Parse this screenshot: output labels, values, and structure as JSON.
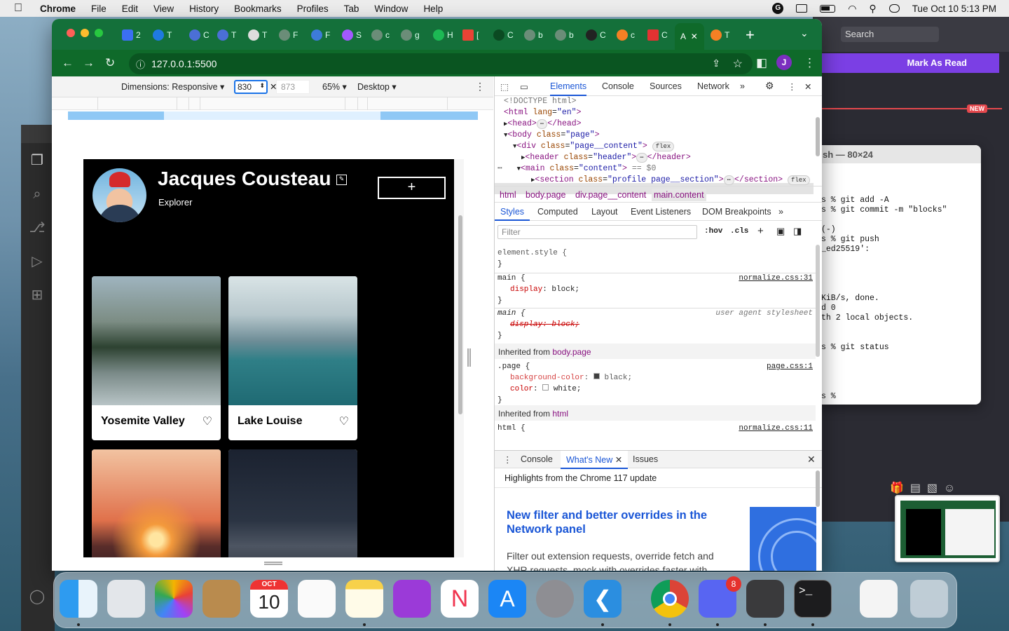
{
  "menubar": {
    "app": "Chrome",
    "items": [
      "File",
      "Edit",
      "View",
      "History",
      "Bookmarks",
      "Profiles",
      "Tab",
      "Window",
      "Help"
    ],
    "datetime": "Tue Oct 10  5:13 PM"
  },
  "background": {
    "search_placeholder": "Search",
    "mark_as_read": "Mark As Read",
    "new_badge": "NEW",
    "terminal_title": "sh — 80×24",
    "terminal_lines": [
      "s % git add -A",
      "s % git commit -m \"blocks\"",
      "(-)",
      "s % git push",
      "_ed25519':",
      "KiB/s, done.",
      "d 0",
      "th 2 local objects.",
      "s % git status",
      "s % "
    ]
  },
  "chrome": {
    "url": "127.0.0.1:5500",
    "tabs": [
      "2",
      "T",
      "C",
      "T",
      "T",
      "F",
      "F",
      "S",
      "c",
      "g",
      "H",
      "[",
      "C",
      "b",
      "b",
      "C",
      "c",
      "C",
      "A",
      "T"
    ],
    "active_tab_label": "A",
    "profile_initial": "J"
  },
  "device_toolbar": {
    "dimensions": "Dimensions: Responsive",
    "width": "830",
    "height": "873",
    "zoom": "65%",
    "mode": "Desktop"
  },
  "page": {
    "name": "Jacques Cousteau",
    "job": "Explorer",
    "add_button": "+",
    "cards": [
      {
        "title": "Yosemite Valley"
      },
      {
        "title": "Lake Louise"
      },
      {
        "title": ""
      },
      {
        "title": ""
      }
    ]
  },
  "devtools": {
    "tabs": [
      "Elements",
      "Console",
      "Sources",
      "Network"
    ],
    "dom": {
      "l1": "<!DOCTYPE html>",
      "l2_tag": "<html ",
      "l2_attr": "lang",
      "l2_val": "\"en\"",
      "l3": "<head>",
      "l3_end": "</head>",
      "l4_tag": "<body ",
      "l4_attr": "class",
      "l4_val": "\"page\"",
      "l5_tag": "<div ",
      "l5_attr": "class",
      "l5_val": "\"page__content\"",
      "l6_tag": "<header ",
      "l6_attr": "class",
      "l6_val": "\"header\"",
      "l6_end": "</header>",
      "l7_tag": "<main ",
      "l7_attr": "class",
      "l7_val": "\"content\"",
      "l7_ref": "== $0",
      "l8_tag": "<section ",
      "l8_attr": "class",
      "l8_val": "\"profile page__section\"",
      "l8_end": "</section>",
      "pill": "flex"
    },
    "breadcrumbs": [
      "html",
      "body.page",
      "div.page__content",
      "main.content"
    ],
    "style_tabs": [
      "Styles",
      "Computed",
      "Layout",
      "Event Listeners",
      "DOM Breakpoints"
    ],
    "filter_placeholder": "Filter",
    "hov": ":hov",
    "cls": ".cls",
    "rules": {
      "element_style": "element.style {",
      "close": "}",
      "main_sel": "main {",
      "main_prop": "display",
      "main_val": "block;",
      "main_src": "normalize.css:31",
      "ua_sel": "main {",
      "ua_prop": "display: block;",
      "ua_src": "user agent stylesheet",
      "inherited_body": "Inherited from ",
      "inherited_body_sel": "body.page",
      "page_sel": ".page {",
      "page_p1": "background-color",
      "page_v1": "black;",
      "page_p2": "color",
      "page_v2": "white;",
      "page_src": "page.css:1",
      "inherited_html": "Inherited from ",
      "inherited_html_sel": "html",
      "html_sel": "html {",
      "html_src": "normalize.css:11"
    },
    "drawer": {
      "tabs": [
        "Console",
        "What's New",
        "Issues"
      ],
      "highlight": "Highlights from the Chrome 117 update",
      "title": "New filter and better overrides in the Network panel",
      "body": "Filter out extension requests, override fetch and XHR requests, mock with overrides faster with better UI, and more."
    }
  },
  "dock": {
    "calendar_month": "OCT",
    "calendar_day": "10",
    "discord_badge": "8"
  }
}
